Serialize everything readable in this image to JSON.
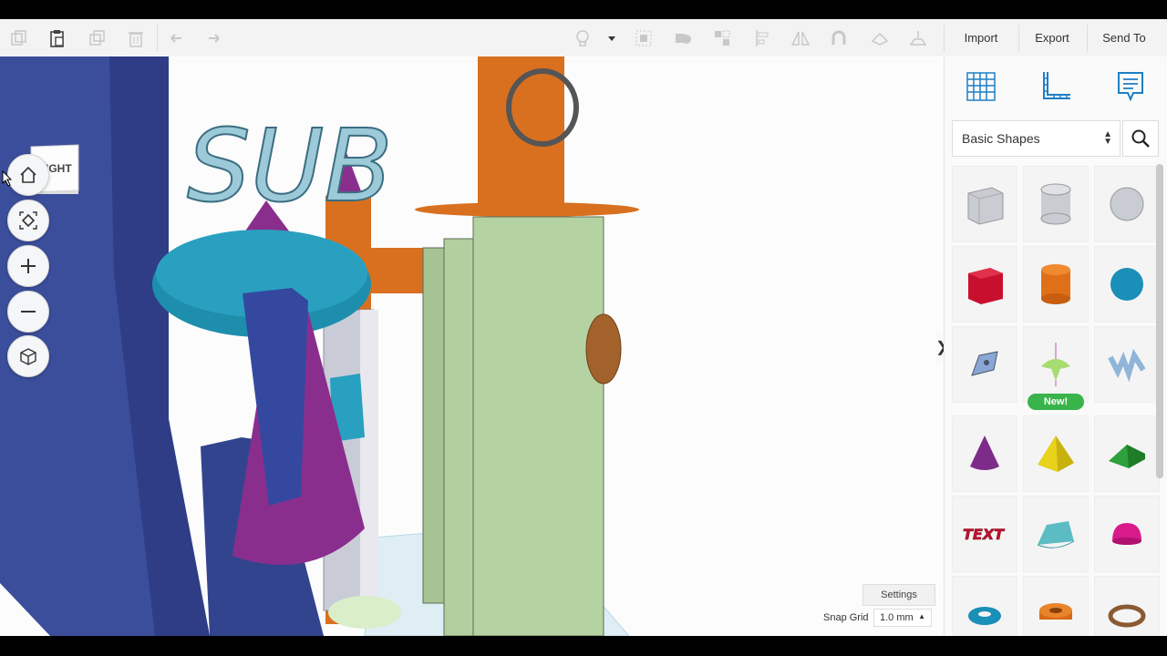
{
  "toolbar": {
    "import_label": "Import",
    "export_label": "Export",
    "send_to_label": "Send To",
    "icons": [
      "copy-icon",
      "paste-icon",
      "duplicate-icon",
      "delete-icon",
      "undo-icon",
      "redo-icon",
      "lightbulb-icon",
      "dropdown-icon",
      "group-icon",
      "solid-icon",
      "ungroup-icon",
      "align-icon",
      "mirror-icon",
      "magnet-icon",
      "cruise-icon",
      "workplane-icon"
    ]
  },
  "viewport": {
    "view_cube_label": "RIGHT",
    "nav_buttons": [
      "home-icon",
      "fit-view-icon",
      "zoom-in-icon",
      "zoom-out-icon",
      "perspective-icon"
    ],
    "scene_text": "SUB",
    "settings_label": "Settings",
    "snap_grid_label": "Snap Grid",
    "snap_grid_value": "1.0 mm"
  },
  "panel": {
    "tabs": [
      "grid-icon",
      "ruler-icon",
      "notes-icon"
    ],
    "library_value": "Basic Shapes",
    "new_badge": "New!",
    "shape_text_label": "TEXT",
    "shapes": [
      "box-hole",
      "cylinder-hole",
      "sphere-hole",
      "box",
      "cylinder",
      "sphere",
      "scribble",
      "shape-generator",
      "text-3d",
      "cone",
      "pyramid",
      "roof",
      "text",
      "half-sphere",
      "paraboloid",
      "torus",
      "tube",
      "ring"
    ]
  },
  "colors": {
    "toolbar_bg": "#f3f3f3",
    "viewport_bg": "#fcfcfd",
    "panel_bg": "#fafafa",
    "new_badge": "#39b44a"
  }
}
